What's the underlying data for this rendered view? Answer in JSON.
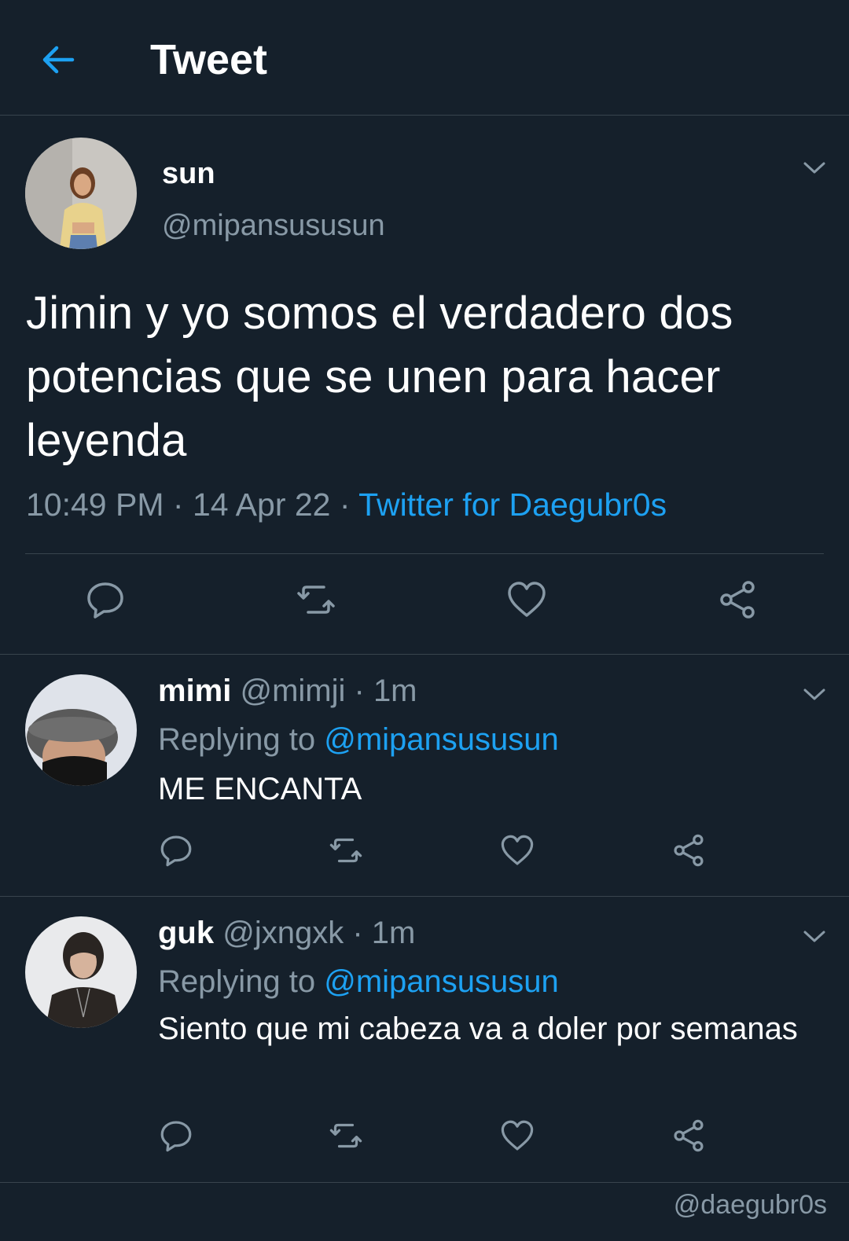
{
  "header": {
    "title": "Tweet",
    "back_icon": "arrow-left-icon"
  },
  "tweet": {
    "name": "sun",
    "handle": "@mipansususun",
    "text": "Jimin y yo somos el verdadero dos potencias que se unen para hacer leyenda",
    "time": "10:49 PM",
    "date": "14 Apr 22",
    "source": "Twitter for Daegubr0s",
    "separator": " · ",
    "actions": [
      "reply-icon",
      "retweet-icon",
      "like-icon",
      "share-icon"
    ]
  },
  "replies": [
    {
      "name": "mimi",
      "handle": "@mimji",
      "age": "1m",
      "replying_prefix": "Replying to ",
      "replying_to": "@mipansususun",
      "text": "ME ENCANTA"
    },
    {
      "name": "guk",
      "handle": "@jxngxk",
      "age": "1m",
      "replying_prefix": "Replying to ",
      "replying_to": "@mipansususun",
      "text": "Siento que mi cabeza va a doler por semanas"
    }
  ],
  "watermark": "@daegubr0s",
  "colors": {
    "background": "#15202b",
    "accent": "#1da1f2",
    "muted": "#8899a6",
    "divider": "#38444d"
  }
}
